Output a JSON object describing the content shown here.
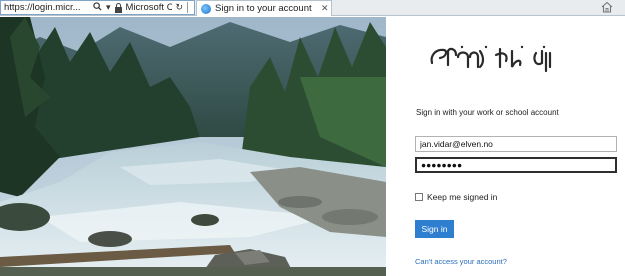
{
  "browser": {
    "address_url": "https://login.micr...",
    "site_identity": "Microsoft C...",
    "tab_title": "Sign in to your account",
    "search_icon": "search-icon",
    "lock_icon": "lock-icon",
    "home_icon": "home-icon"
  },
  "signin": {
    "logo_alt": "Tengwar logo",
    "heading": "Sign in with your work or school account",
    "email_value": "jan.vidar@elven.no",
    "password_value": "●●●●●●●●",
    "keep_signed_in_label": "Keep me signed in",
    "keep_signed_in_checked": false,
    "submit_label": "Sign in",
    "cant_access_link": "Can't access your account?"
  },
  "colors": {
    "accent": "#2f7fd1",
    "link": "#2a6ebb"
  }
}
